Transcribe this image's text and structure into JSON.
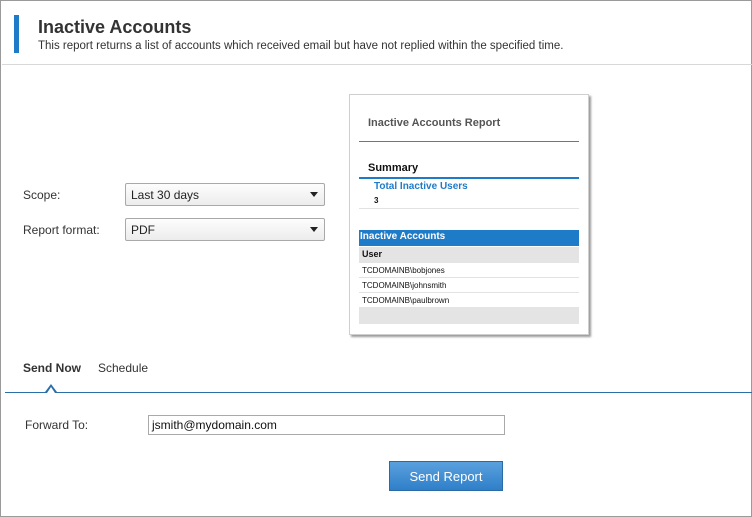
{
  "header": {
    "title": "Inactive Accounts",
    "subtitle": "This report returns a list of accounts which received email but have not replied within the specified time."
  },
  "form": {
    "scope_label": "Scope:",
    "scope_value": "Last 30 days",
    "format_label": "Report format:",
    "format_value": "PDF"
  },
  "preview": {
    "title": "Inactive Accounts Report",
    "summary_heading": "Summary",
    "total_label": "Total Inactive Users",
    "total_value": "3",
    "table_title": "Inactive Accounts",
    "column_header": "User",
    "rows": [
      "TCDOMAINB\\bobjones",
      "TCDOMAINB\\johnsmith",
      "TCDOMAINB\\paulbrown"
    ]
  },
  "tabs": {
    "send_now": "Send Now",
    "schedule": "Schedule"
  },
  "send": {
    "forward_label": "Forward To:",
    "forward_value": "jsmith@mydomain.com",
    "button_label": "Send Report"
  },
  "colors": {
    "accent": "#1e7bc8",
    "button": "#3c8bd3"
  }
}
